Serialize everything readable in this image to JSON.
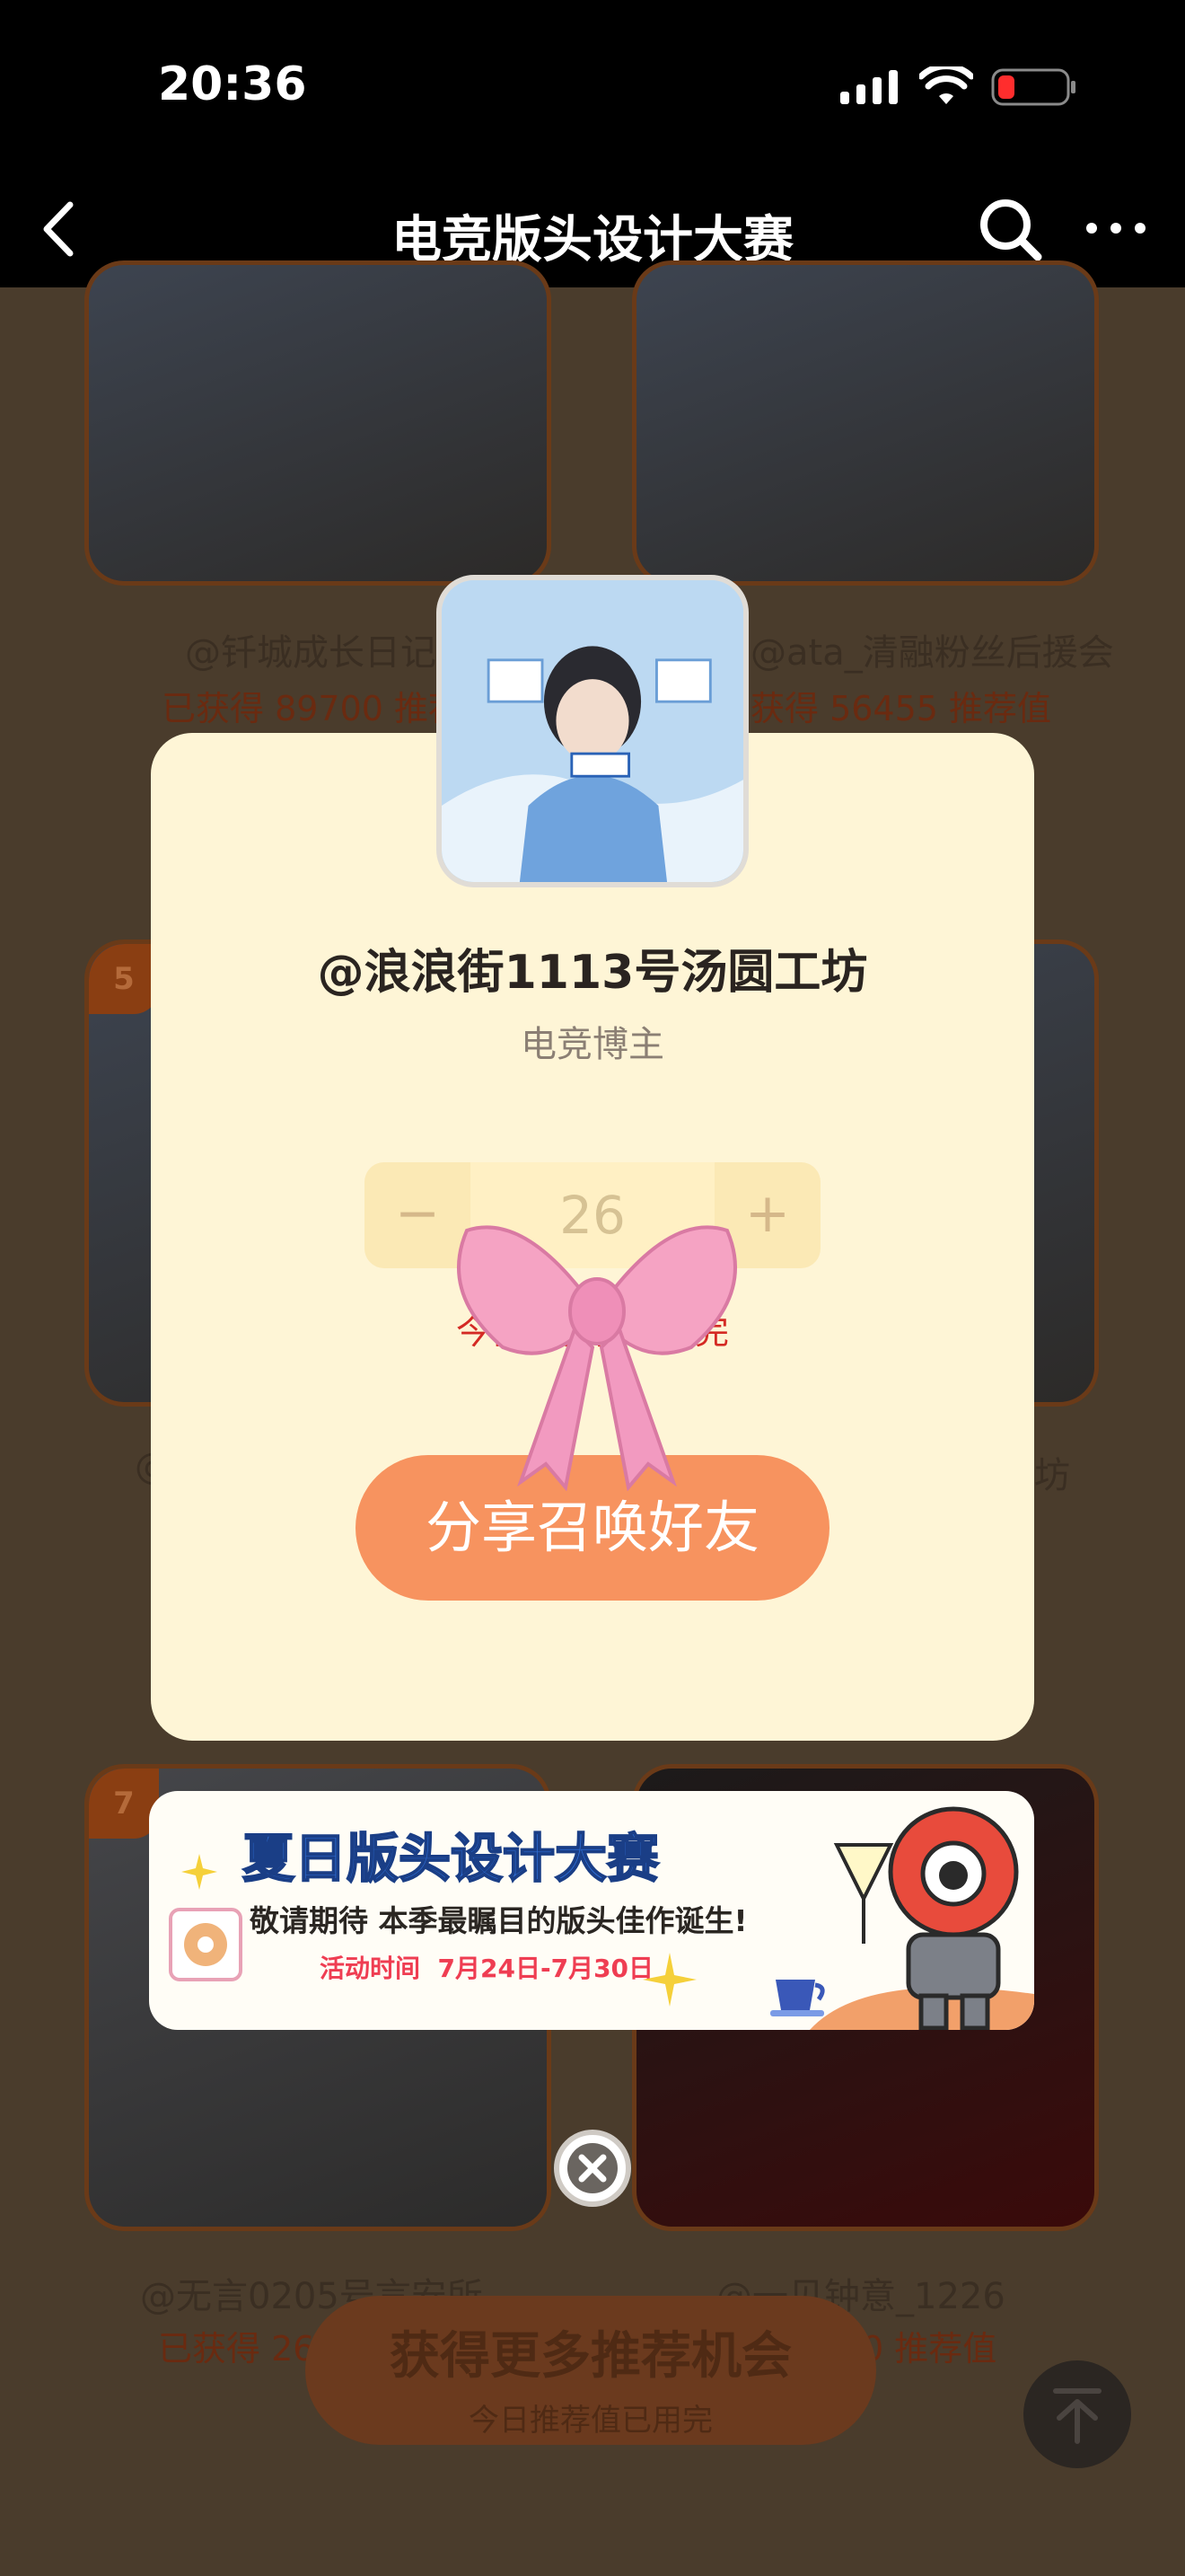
{
  "status_bar": {
    "time": "20:36",
    "icons": [
      "signal-icon",
      "wifi-icon",
      "battery-low-icon"
    ],
    "battery_color": "#ff2d2d"
  },
  "nav": {
    "title": "电竞版头设计大赛",
    "icons": [
      "back-icon",
      "search-icon",
      "more-icon"
    ]
  },
  "background_page": {
    "cards": [
      {
        "name": "@钎城成长日记",
        "score": "已获得 89700 推荐值"
      },
      {
        "name": "@ata_清融粉丝后援会",
        "score": "获得 56455 推荐值"
      },
      {
        "rank": "5",
        "name": "@",
        "score": ""
      },
      {
        "rank": "",
        "name": "坊",
        "score": ""
      },
      {
        "rank": "7",
        "name": "@无言0205号言安所",
        "score": "已获得 26"
      },
      {
        "rank": "",
        "name": "@一见钟意_1226",
        "score": "0 推荐值"
      }
    ],
    "cta": {
      "title": "获得更多推荐机会",
      "subtitle": "今日推荐值已用完"
    }
  },
  "modal": {
    "user_name": "@浪浪街1113号汤圆工坊",
    "user_role": "电竞博主",
    "stepper": {
      "minus": "−",
      "value": "26",
      "plus": "+"
    },
    "limit_note": "今日推荐值已用完",
    "share_button": "分享召唤好友"
  },
  "banner": {
    "title": "夏日版头设计大赛",
    "subtitle": "敬请期待 本季最瞩目的版头佳作诞生!",
    "time_label": "活动时间",
    "time_range": "7月24日-7月30日"
  },
  "colors": {
    "accent": "#f7935f",
    "modal_bg": "#fef5d6",
    "alert": "#d42a24",
    "banner_title": "#2f6fd6"
  }
}
